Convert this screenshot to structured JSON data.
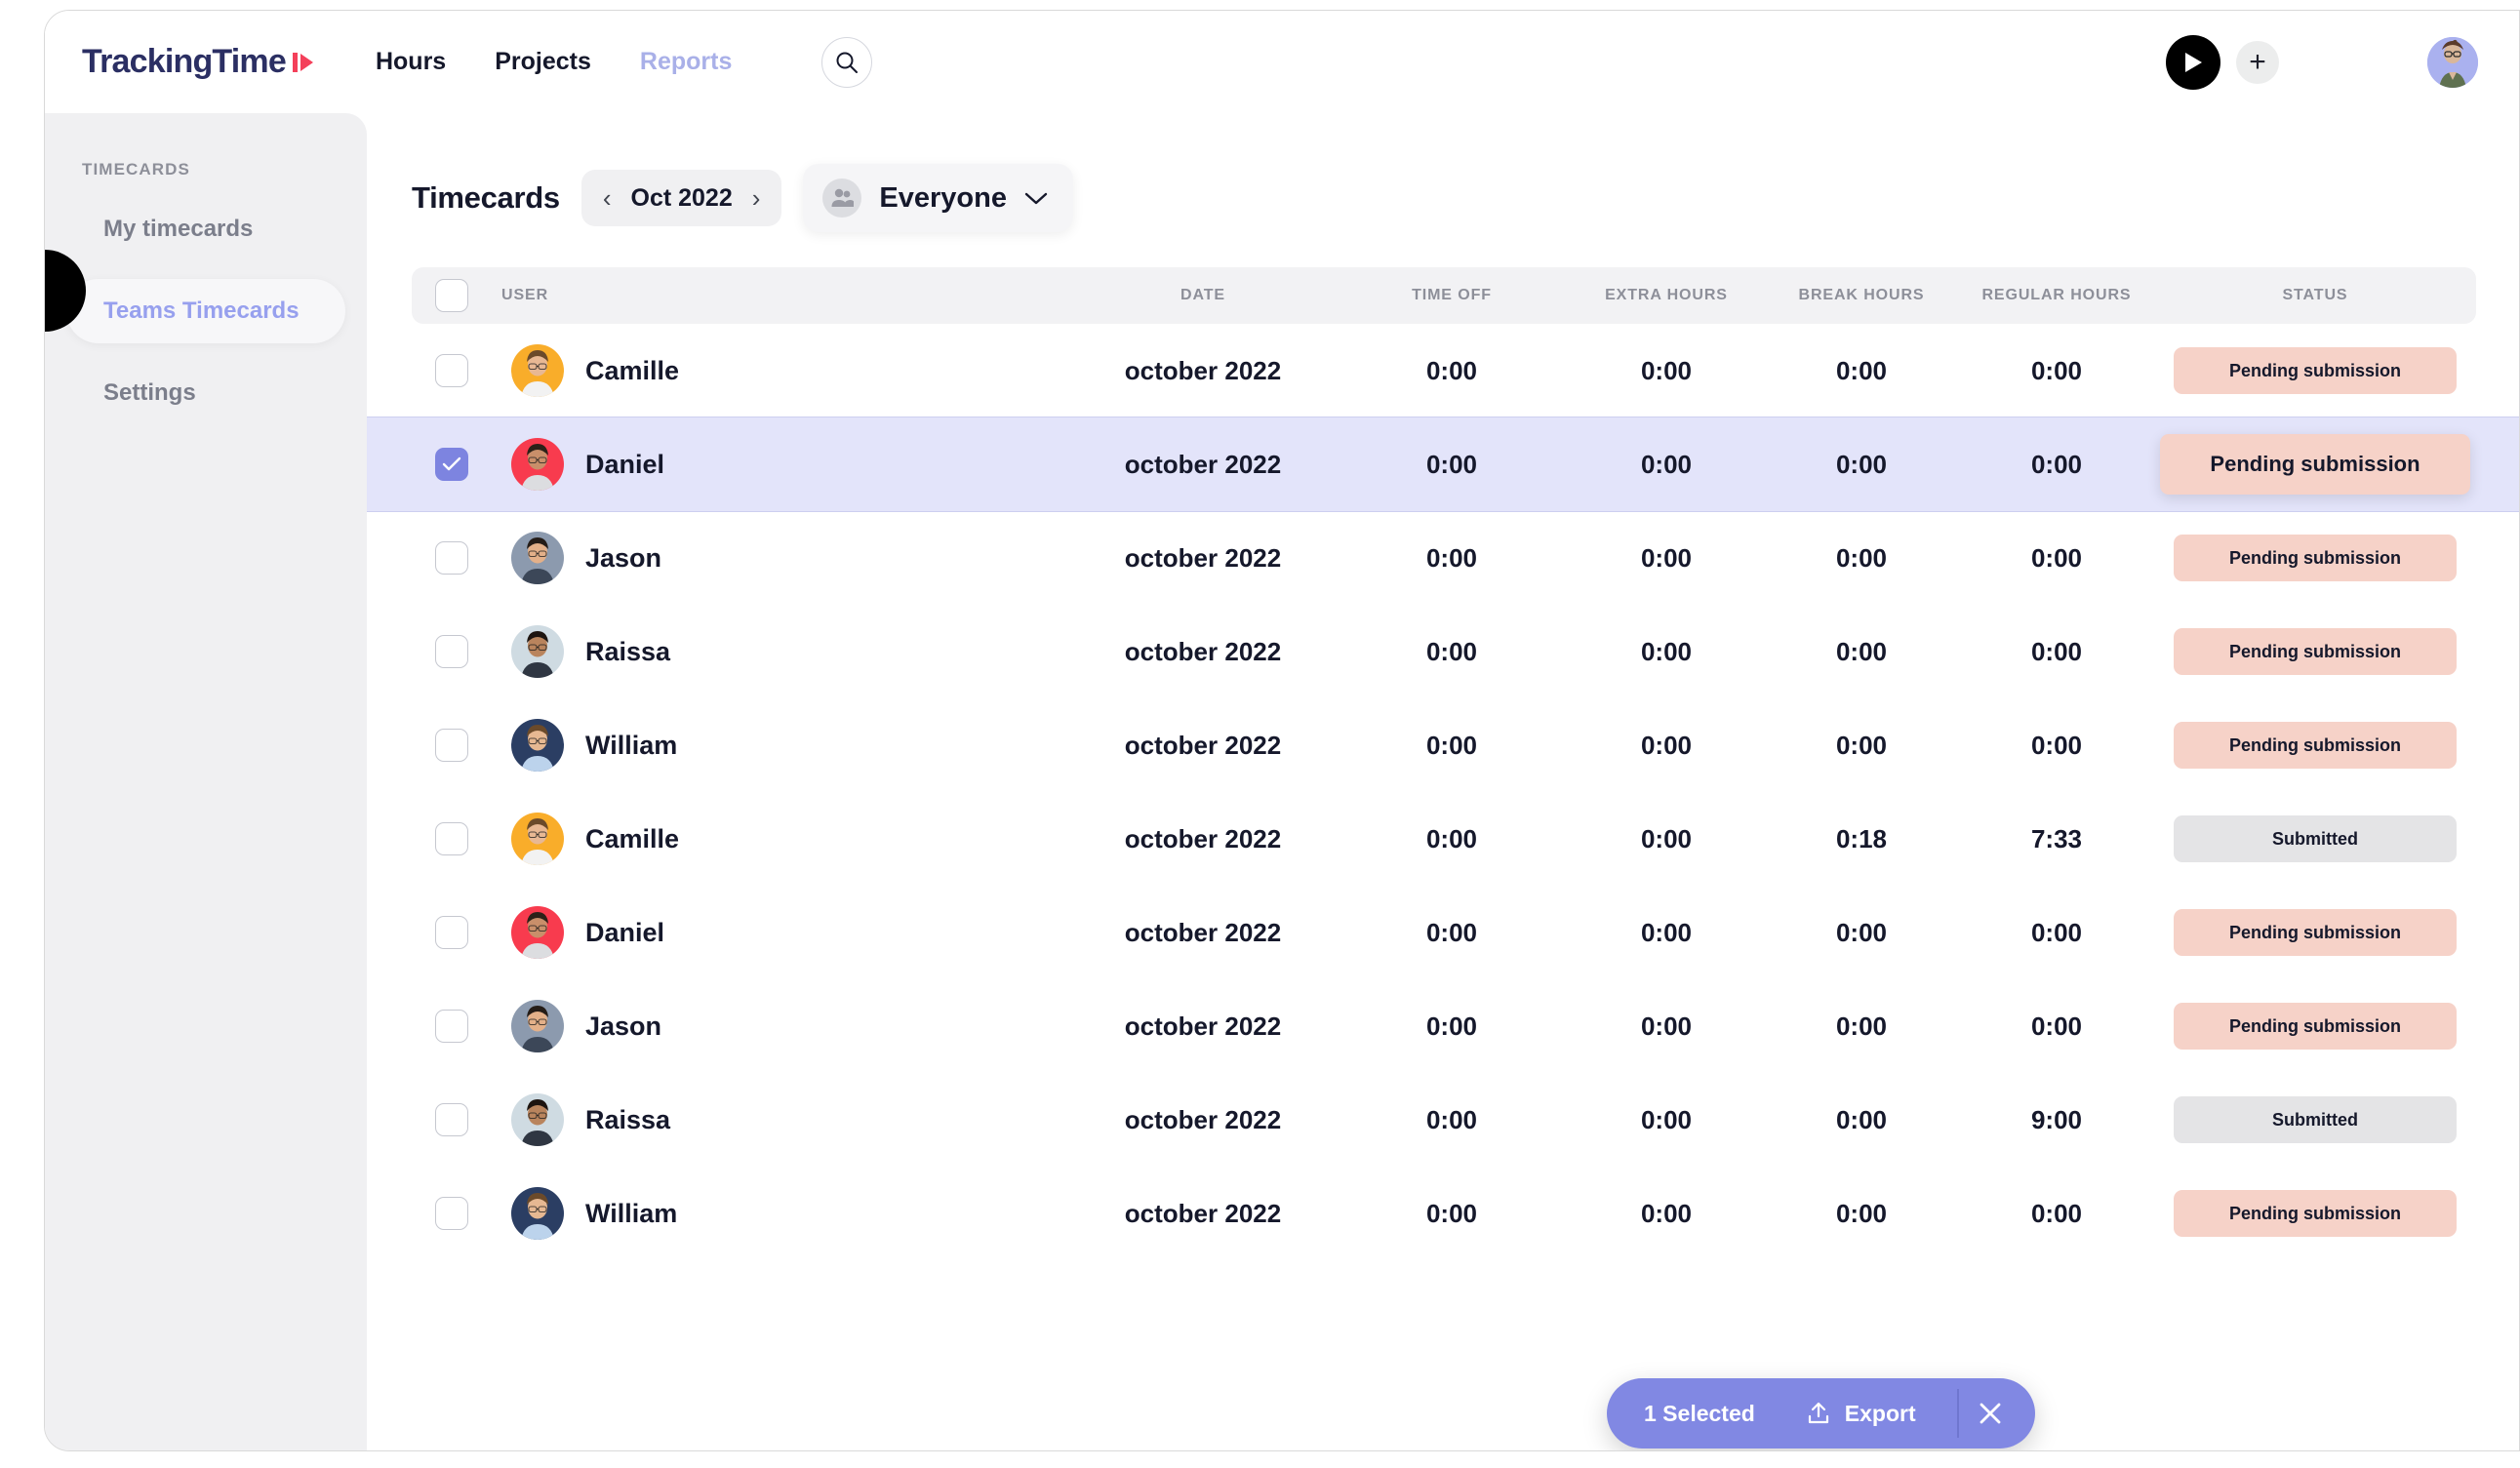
{
  "brand": {
    "name": "TrackingTime",
    "logo_icon": "play-badge-icon"
  },
  "topnav": {
    "links": [
      {
        "label": "Hours",
        "active": true
      },
      {
        "label": "Projects",
        "active": true
      },
      {
        "label": "Reports",
        "active": false
      }
    ],
    "search_icon": "search-icon",
    "play_icon": "play-icon",
    "add_icon": "plus-icon",
    "avatar_name": "user-avatar"
  },
  "sidebar": {
    "heading": "TIMECARDS",
    "items": [
      {
        "label": "My timecards",
        "active": false
      },
      {
        "label": "Teams Timecards",
        "active": true
      },
      {
        "label": "Settings",
        "active": false
      }
    ]
  },
  "page": {
    "title": "Timecards",
    "date_range": "Oct 2022",
    "prev_icon": "chevron-left-icon",
    "next_icon": "chevron-right-icon",
    "people_filter": "Everyone",
    "people_icon": "people-icon",
    "people_chevron": "chevron-down-icon"
  },
  "table": {
    "columns": [
      "USER",
      "DATE",
      "TIME OFF",
      "EXTRA HOURS",
      "BREAK HOURS",
      "REGULAR HOURS",
      "STATUS"
    ],
    "rows": [
      {
        "user": "Camille",
        "date": "october 2022",
        "time_off": "0:00",
        "extra_hours": "0:00",
        "break_hours": "0:00",
        "regular_hours": "0:00",
        "status": "Pending submission",
        "status_kind": "pending",
        "selected": false,
        "avatar_color": "#f9ad2a"
      },
      {
        "user": "Daniel",
        "date": "october 2022",
        "time_off": "0:00",
        "extra_hours": "0:00",
        "break_hours": "0:00",
        "regular_hours": "0:00",
        "status": "Pending submission",
        "status_kind": "pending",
        "selected": true,
        "avatar_color": "#f83b4e"
      },
      {
        "user": "Jason",
        "date": "october 2022",
        "time_off": "0:00",
        "extra_hours": "0:00",
        "break_hours": "0:00",
        "regular_hours": "0:00",
        "status": "Pending submission",
        "status_kind": "pending",
        "selected": false,
        "avatar_color": "#8c9aae"
      },
      {
        "user": "Raissa",
        "date": "october 2022",
        "time_off": "0:00",
        "extra_hours": "0:00",
        "break_hours": "0:00",
        "regular_hours": "0:00",
        "status": "Pending submission",
        "status_kind": "pending",
        "selected": false,
        "avatar_color": "#cfdbe2"
      },
      {
        "user": "William",
        "date": "october 2022",
        "time_off": "0:00",
        "extra_hours": "0:00",
        "break_hours": "0:00",
        "regular_hours": "0:00",
        "status": "Pending submission",
        "status_kind": "pending",
        "selected": false,
        "avatar_color": "#2b3e63"
      },
      {
        "user": "Camille",
        "date": "october 2022",
        "time_off": "0:00",
        "extra_hours": "0:00",
        "break_hours": "0:18",
        "regular_hours": "7:33",
        "status": "Submitted",
        "status_kind": "submitted",
        "selected": false,
        "avatar_color": "#f9ad2a"
      },
      {
        "user": "Daniel",
        "date": "october 2022",
        "time_off": "0:00",
        "extra_hours": "0:00",
        "break_hours": "0:00",
        "regular_hours": "0:00",
        "status": "Pending submission",
        "status_kind": "pending",
        "selected": false,
        "avatar_color": "#f83b4e"
      },
      {
        "user": "Jason",
        "date": "october 2022",
        "time_off": "0:00",
        "extra_hours": "0:00",
        "break_hours": "0:00",
        "regular_hours": "0:00",
        "status": "Pending submission",
        "status_kind": "pending",
        "selected": false,
        "avatar_color": "#8c9aae"
      },
      {
        "user": "Raissa",
        "date": "october 2022",
        "time_off": "0:00",
        "extra_hours": "0:00",
        "break_hours": "0:00",
        "regular_hours": "9:00",
        "status": "Submitted",
        "status_kind": "submitted",
        "selected": false,
        "avatar_color": "#cfdbe2"
      },
      {
        "user": "William",
        "date": "october 2022",
        "time_off": "0:00",
        "extra_hours": "0:00",
        "break_hours": "0:00",
        "regular_hours": "0:00",
        "status": "Pending submission",
        "status_kind": "pending",
        "selected": false,
        "avatar_color": "#2b3e63"
      }
    ]
  },
  "action_bar": {
    "count_label": "1 Selected",
    "export_label": "Export",
    "export_icon": "upload-icon",
    "close_icon": "close-icon"
  },
  "colors": {
    "accent": "#8188e3",
    "selected_row": "#e3e4fa",
    "pending_badge": "#f6d2c8",
    "submitted_badge": "#e4e4e6",
    "brand_navy": "#2b2f63",
    "brand_red": "#f4405a"
  }
}
